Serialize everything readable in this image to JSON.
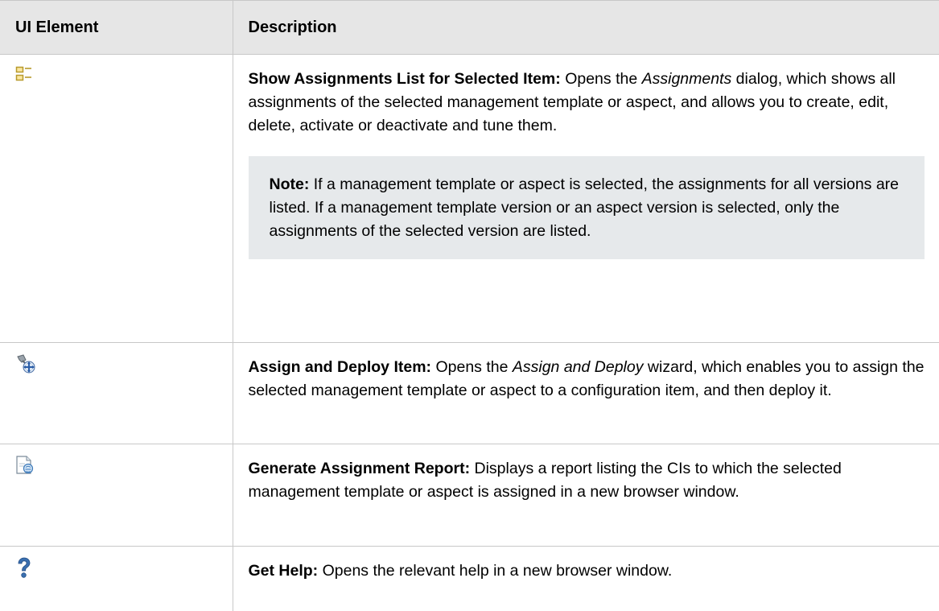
{
  "table": {
    "headers": [
      "UI Element",
      "Description"
    ],
    "rows": [
      {
        "icon": "assignments-list-icon",
        "title": "Show Assignments List for Selected Item:",
        "text_before": " Opens the ",
        "italic": "Assignments",
        "text_after": " dialog, which shows all assignments of the selected management template or aspect, and allows you to create, edit, delete, activate or deactivate and tune them.",
        "note": {
          "label": "Note:",
          "text": " If a management template or aspect is selected, the assignments for all versions are listed. If a management template version or an aspect version is selected, only the assignments of the selected version are listed."
        }
      },
      {
        "icon": "assign-deploy-icon",
        "title": "Assign and Deploy Item:",
        "text_before": " Opens the ",
        "italic": "Assign and Deploy",
        "text_after": " wizard, which enables you to assign the selected management template or aspect to a configuration item, and then deploy it."
      },
      {
        "icon": "assignment-report-icon",
        "title": "Generate Assignment Report:",
        "text": " Displays a report listing the CIs to which the selected management template or aspect is assigned in a new browser window."
      },
      {
        "icon": "help-icon",
        "title": "Get Help:",
        "text": " Opens the relevant help in a new browser window."
      }
    ]
  }
}
